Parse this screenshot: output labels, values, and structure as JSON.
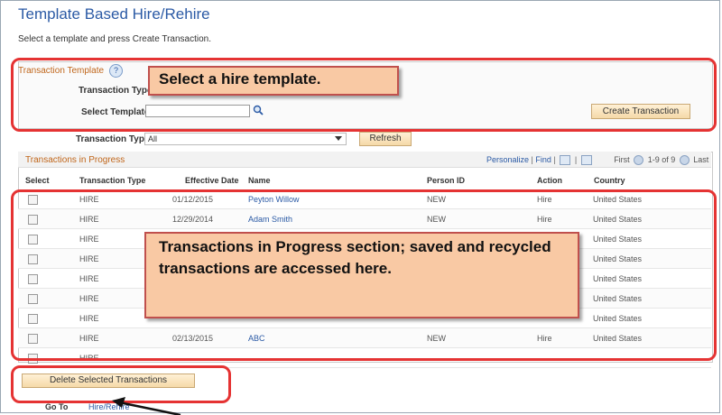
{
  "page": {
    "title": "Template Based Hire/Rehire",
    "instructions": "Select a template and press Create Transaction."
  },
  "template_section": {
    "header": "Transaction Template",
    "type_label": "Transaction Type",
    "select_label": "Select Template",
    "select_value": "",
    "create_button": "Create Transaction"
  },
  "filter": {
    "type_label": "Transaction Type",
    "type_value": "All",
    "refresh_button": "Refresh"
  },
  "grid": {
    "title": "Transactions in Progress",
    "personalize": "Personalize",
    "find": "Find",
    "first": "First",
    "range": "1-9 of 9",
    "last": "Last",
    "columns": [
      "Select",
      "Transaction Type",
      "Effective Date",
      "Name",
      "Person ID",
      "Action",
      "Country"
    ],
    "rows": [
      {
        "type": "HIRE",
        "date": "01/12/2015",
        "name": "Peyton Willow",
        "person_id": "NEW",
        "action": "Hire",
        "country": "United States"
      },
      {
        "type": "HIRE",
        "date": "12/29/2014",
        "name": "Adam Smith",
        "person_id": "NEW",
        "action": "Hire",
        "country": "United States"
      },
      {
        "type": "HIRE",
        "date": "",
        "name": "",
        "person_id": "",
        "action": "",
        "country": "United States"
      },
      {
        "type": "HIRE",
        "date": "",
        "name": "",
        "person_id": "",
        "action": "",
        "country": "United States"
      },
      {
        "type": "HIRE",
        "date": "",
        "name": "",
        "person_id": "",
        "action": "",
        "country": "United States"
      },
      {
        "type": "HIRE",
        "date": "",
        "name": "",
        "person_id": "",
        "action": "",
        "country": "United States"
      },
      {
        "type": "HIRE",
        "date": "",
        "name": "",
        "person_id": "",
        "action": "",
        "country": "United States"
      },
      {
        "type": "HIRE",
        "date": "02/13/2015",
        "name": "ABC",
        "person_id": "NEW",
        "action": "Hire",
        "country": "United States"
      },
      {
        "type": "HIRE",
        "date": "",
        "name": "",
        "person_id": "",
        "action": "",
        "country": ""
      }
    ]
  },
  "actions": {
    "delete_button": "Delete Selected Transactions",
    "goto_label": "Go To",
    "goto_link": "Hire/Rehire"
  },
  "callouts": {
    "template": "Select a hire template.",
    "transactions": "Transactions in Progress section; saved and recycled transactions are accessed here."
  },
  "colors": {
    "title": "#2b5aa5",
    "section_header": "#c0661b",
    "highlight": "#e53333",
    "callout_fill": "#f9c9a4"
  }
}
